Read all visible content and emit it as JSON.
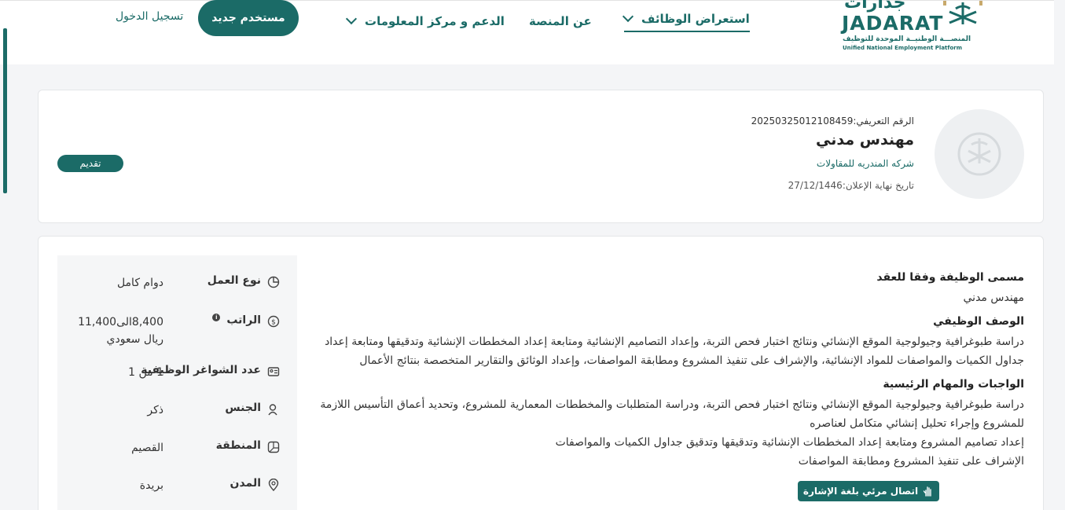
{
  "header": {
    "logo_word": "JADARAT",
    "logo_arabic": "جدارات",
    "logo_sub_ar": "المنصـــة الوطنيــة الموحدة للتوظيف",
    "logo_sub_en": "Unified National Employment Platform",
    "nav": {
      "browse_jobs": "استعراض الوظائف",
      "about": "عن المنصة",
      "support": "الدعم و مركز المعلومات"
    },
    "new_user": "مستخدم جديد",
    "login": "تسجيل الدخول"
  },
  "job": {
    "id_text": "الرقم التعريفي:20250325012108459",
    "title": "مهندس مدني",
    "company": "شركه المندريه للمقاولات",
    "deadline": "تاريخ نهاية الإعلان:27/12/1446",
    "apply": "تقديم"
  },
  "details": [
    {
      "icon": "pie-chart-icon",
      "label": "نوع العمل",
      "value": "دوام كامل"
    },
    {
      "icon": "money-icon",
      "label": "الراتب",
      "value": "8,400الى11,400 ريال سعودي"
    },
    {
      "icon": "id-card-icon",
      "label": "عدد الشواغر الوظيفية",
      "value": "1 من 1"
    },
    {
      "icon": "gender-icon",
      "label": "الجنس",
      "value": "ذكر"
    },
    {
      "icon": "map-icon",
      "label": "المنطقة",
      "value": "القصيم"
    },
    {
      "icon": "location-pin-icon",
      "label": "المدن",
      "value": "بريدة"
    }
  ],
  "content": {
    "contract_title_heading": "مسمى الوظيفة وفقا للعقد",
    "contract_title_value": "مهندس مدني",
    "description_heading": "الوصف الوظيفي",
    "description_text": "دراسة طبوغرافية وجيولوجية الموقع الإنشائي ونتائج اختبار فحص التربة، وإعداد التصاميم الإنشائية ومتابعة إعداد المخططات الإنشائية وتدقيقها ومتابعة إعداد جداول الكميات والمواصفات للمواد الإنشائية، والإشراف على تنفيذ المشروع ومطابقة المواصفات، وإعداد الوثائق والتقارير المتخصصة بنتائج الأعمال",
    "duties_heading": "الواجبات والمهام الرئيسية",
    "duties": [
      "دراسة طبوغرافية وجيولوجية الموقع الإنشائي ونتائج اختبار فحص التربة، ودراسة المتطلبات والمخططات المعمارية للمشروع، وتحديد أعماق التأسيس اللازمة للمشروع وإجراء تحليل إنشائي متكامل لعناصره",
      "إعداد تصاميم المشروع ومتابعة إعداد المخططات الإنشائية وتدقيقها وتدقيق جداول الكميات والمواصفات",
      "الإشراف على تنفيذ المشروع ومطابقة المواصفات"
    ]
  },
  "sign_language": "اتصال مرئي بلغة الإشارة",
  "colors": {
    "brand": "#1b6b67",
    "background": "#f4f5f7"
  }
}
